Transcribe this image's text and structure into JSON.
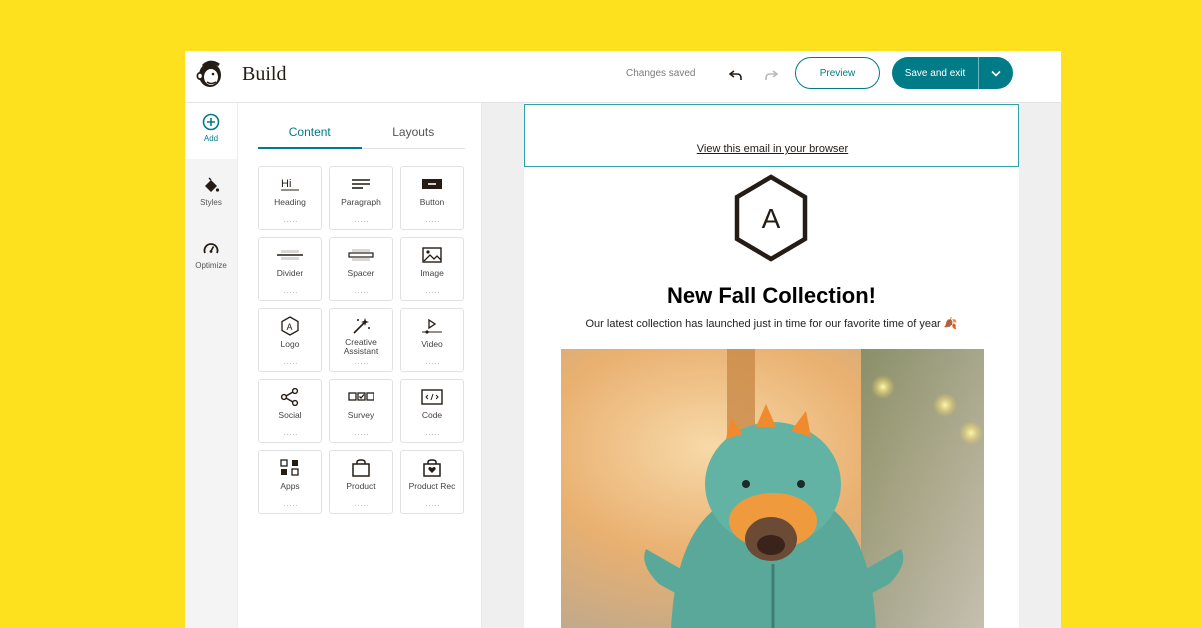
{
  "header": {
    "app_title": "Build",
    "status": "Changes saved",
    "preview_label": "Preview",
    "save_label": "Save and exit"
  },
  "rail": {
    "items": [
      {
        "label": "Add",
        "icon": "plus-circle-icon"
      },
      {
        "label": "Styles",
        "icon": "paint-bucket-icon"
      },
      {
        "label": "Optimize",
        "icon": "gauge-icon"
      }
    ]
  },
  "panel": {
    "tabs": [
      "Content",
      "Layouts"
    ],
    "blocks": [
      {
        "label": "Heading",
        "icon": "heading-icon"
      },
      {
        "label": "Paragraph",
        "icon": "paragraph-icon"
      },
      {
        "label": "Button",
        "icon": "button-icon"
      },
      {
        "label": "Divider",
        "icon": "divider-icon"
      },
      {
        "label": "Spacer",
        "icon": "spacer-icon"
      },
      {
        "label": "Image",
        "icon": "image-icon"
      },
      {
        "label": "Logo",
        "icon": "logo-icon"
      },
      {
        "label": "Creative Assistant",
        "icon": "magic-wand-icon"
      },
      {
        "label": "Video",
        "icon": "video-icon"
      },
      {
        "label": "Social",
        "icon": "share-icon"
      },
      {
        "label": "Survey",
        "icon": "survey-icon"
      },
      {
        "label": "Code",
        "icon": "code-icon"
      },
      {
        "label": "Apps",
        "icon": "apps-icon"
      },
      {
        "label": "Product",
        "icon": "shopping-bag-icon"
      },
      {
        "label": "Product Rec",
        "icon": "product-rec-icon"
      }
    ],
    "heading_icon_text": "Hi"
  },
  "email": {
    "view_in_browser": "View this email in your browser",
    "logo_letter": "A",
    "headline": "New Fall Collection!",
    "subline": "Our latest collection has launched just in time for our favorite time of year 🍂"
  },
  "colors": {
    "background": "#FDE01E",
    "accent": "#007C89",
    "rail": "#F4F4F4",
    "canvas": "#EFEFEF"
  }
}
